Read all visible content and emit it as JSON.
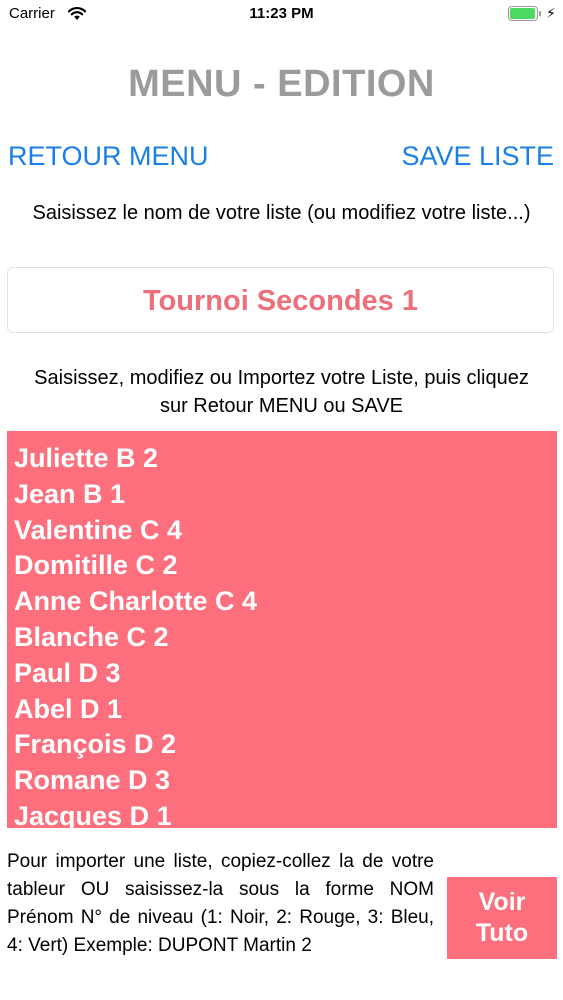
{
  "status_bar": {
    "carrier": "Carrier",
    "time": "11:23 PM",
    "battery_level": 1.0,
    "charging_icon": "bolt-icon"
  },
  "header": {
    "title": "MENU - EDITION",
    "left_button": "RETOUR  MENU",
    "right_button": "SAVE  LISTE"
  },
  "name_section": {
    "instruction": "Saisissez le nom de votre liste (ou modifiez votre liste...)",
    "list_name": "Tournoi Secondes 1"
  },
  "list_section": {
    "instruction": "Saisissez, modifiez ou Importez votre Liste, puis cliquez sur Retour MENU ou SAVE",
    "entries": [
      "Juliette B 2",
      "Jean B 1",
      "Valentine C 4",
      "Domitille C 2",
      "Anne Charlotte C 4",
      "Blanche C 2",
      "Paul D 3",
      "Abel D 1",
      "François D 2",
      "Romane D 3",
      "Jacques D 1"
    ]
  },
  "footer": {
    "help_text": "Pour importer une liste, copiez-collez la de votre tableur OU saisissez-la sous la forme NOM Prénom N° de niveau (1: Noir, 2: Rouge, 3: Bleu, 4: Vert) Exemple: DUPONT Martin 2",
    "tuto_button": "Voir Tuto"
  },
  "colors": {
    "accent_pink": "#fe6f7d",
    "link_blue": "#1a7fe6",
    "title_gray": "#9b9b9b"
  }
}
